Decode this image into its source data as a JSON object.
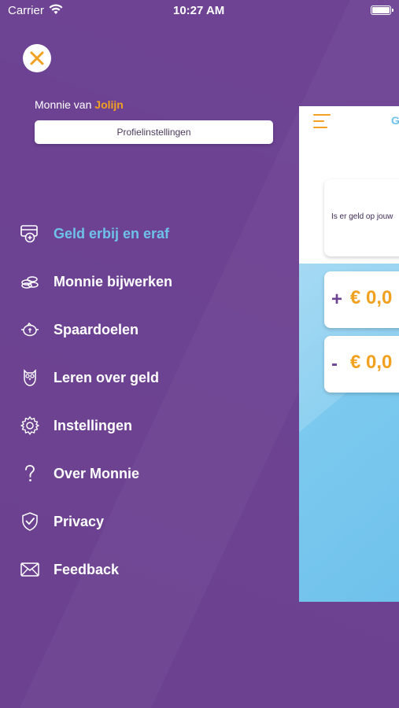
{
  "status_bar": {
    "carrier": "Carrier",
    "time": "10:27 AM"
  },
  "profile": {
    "prefix": "Monnie van",
    "first_name": "Jolijn",
    "settings_button": "Profielinstellingen"
  },
  "menu": {
    "items": [
      {
        "label": "Geld erbij en eraf",
        "icon": "wallet-plus-icon",
        "active": true
      },
      {
        "label": "Monnie bijwerken",
        "icon": "coins-icon"
      },
      {
        "label": "Spaardoelen",
        "icon": "piggy-bank-icon"
      },
      {
        "label": "Leren over geld",
        "icon": "owl-icon"
      },
      {
        "label": "Instellingen",
        "icon": "gear-icon"
      },
      {
        "label": "Over Monnie",
        "icon": "question-icon"
      },
      {
        "label": "Privacy",
        "icon": "shield-check-icon"
      },
      {
        "label": "Feedback",
        "icon": "envelope-icon"
      }
    ]
  },
  "preview": {
    "title_fragment": "G",
    "question": "Is er geld op jouw",
    "plus_sign": "+",
    "plus_amount": "€ 0,0",
    "minus_sign": "-",
    "minus_amount": "€ 0,0"
  },
  "colors": {
    "background": "#6e4394",
    "accent_orange": "#f2a01f",
    "active_blue": "#6ec2ea"
  }
}
